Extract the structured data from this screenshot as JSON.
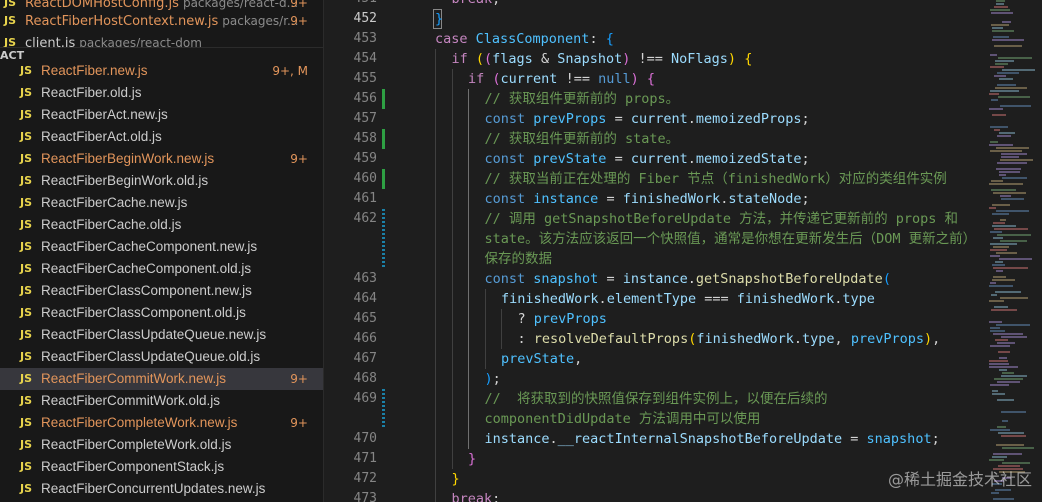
{
  "open_editors": [
    {
      "type": "JS",
      "name": "ReactDOMHostConfig.js",
      "path": "packages/react-d...",
      "badge": "9+"
    },
    {
      "type": "JS",
      "name": "ReactFiberHostContext.new.js",
      "path": "packages/r...",
      "badge": "9+"
    },
    {
      "type": "JS",
      "name": "client.js",
      "path": "packages/react-dom",
      "badge": ""
    }
  ],
  "section_title": "ACT",
  "files": [
    {
      "type": "JS",
      "name": "ReactFiber.new.js",
      "badge": "9+, M",
      "modified": true,
      "selected": false
    },
    {
      "type": "JS",
      "name": "ReactFiber.old.js",
      "badge": "",
      "modified": false,
      "selected": false
    },
    {
      "type": "JS",
      "name": "ReactFiberAct.new.js",
      "badge": "",
      "modified": false,
      "selected": false
    },
    {
      "type": "JS",
      "name": "ReactFiberAct.old.js",
      "badge": "",
      "modified": false,
      "selected": false
    },
    {
      "type": "JS",
      "name": "ReactFiberBeginWork.new.js",
      "badge": "9+",
      "modified": true,
      "selected": false
    },
    {
      "type": "JS",
      "name": "ReactFiberBeginWork.old.js",
      "badge": "",
      "modified": false,
      "selected": false
    },
    {
      "type": "JS",
      "name": "ReactFiberCache.new.js",
      "badge": "",
      "modified": false,
      "selected": false
    },
    {
      "type": "JS",
      "name": "ReactFiberCache.old.js",
      "badge": "",
      "modified": false,
      "selected": false
    },
    {
      "type": "JS",
      "name": "ReactFiberCacheComponent.new.js",
      "badge": "",
      "modified": false,
      "selected": false
    },
    {
      "type": "JS",
      "name": "ReactFiberCacheComponent.old.js",
      "badge": "",
      "modified": false,
      "selected": false
    },
    {
      "type": "JS",
      "name": "ReactFiberClassComponent.new.js",
      "badge": "",
      "modified": false,
      "selected": false
    },
    {
      "type": "JS",
      "name": "ReactFiberClassComponent.old.js",
      "badge": "",
      "modified": false,
      "selected": false
    },
    {
      "type": "JS",
      "name": "ReactFiberClassUpdateQueue.new.js",
      "badge": "",
      "modified": false,
      "selected": false
    },
    {
      "type": "JS",
      "name": "ReactFiberClassUpdateQueue.old.js",
      "badge": "",
      "modified": false,
      "selected": false
    },
    {
      "type": "JS",
      "name": "ReactFiberCommitWork.new.js",
      "badge": "9+",
      "modified": true,
      "selected": true
    },
    {
      "type": "JS",
      "name": "ReactFiberCommitWork.old.js",
      "badge": "",
      "modified": false,
      "selected": false
    },
    {
      "type": "JS",
      "name": "ReactFiberCompleteWork.new.js",
      "badge": "9+",
      "modified": true,
      "selected": false
    },
    {
      "type": "JS",
      "name": "ReactFiberCompleteWork.old.js",
      "badge": "",
      "modified": false,
      "selected": false
    },
    {
      "type": "JS",
      "name": "ReactFiberComponentStack.js",
      "badge": "",
      "modified": false,
      "selected": false
    },
    {
      "type": "JS",
      "name": "ReactFiberConcurrentUpdates.new.js",
      "badge": "",
      "modified": false,
      "selected": false
    }
  ],
  "editor": {
    "line_numbers": [
      "451",
      "452",
      "453",
      "454",
      "455",
      "456",
      "457",
      "458",
      "459",
      "460",
      "461",
      "462",
      "",
      "",
      "463",
      "464",
      "465",
      "466",
      "467",
      "468",
      "469",
      "",
      "470",
      "471",
      "472",
      "473"
    ],
    "active_line": "452",
    "code_lines": [
      {
        "indent": 1,
        "tokens": [
          {
            "t": "break",
            "c": "kw2"
          },
          {
            "t": ";",
            "c": "pn"
          }
        ]
      },
      {
        "indent": 0,
        "tokens": [
          {
            "t": "}",
            "c": "br3"
          }
        ]
      },
      {
        "indent": 0,
        "tokens": [
          {
            "t": "case ",
            "c": "kw2"
          },
          {
            "t": "ClassComponent",
            "c": "cst"
          },
          {
            "t": ": ",
            "c": "pn"
          },
          {
            "t": "{",
            "c": "br3"
          }
        ]
      },
      {
        "indent": 1,
        "tokens": [
          {
            "t": "if ",
            "c": "kw2"
          },
          {
            "t": "(",
            "c": "br1"
          },
          {
            "t": "(",
            "c": "br2"
          },
          {
            "t": "flags",
            "c": "var"
          },
          {
            "t": " & ",
            "c": "pn"
          },
          {
            "t": "Snapshot",
            "c": "var"
          },
          {
            "t": ")",
            "c": "br2"
          },
          {
            "t": " !== ",
            "c": "pn"
          },
          {
            "t": "NoFlags",
            "c": "var"
          },
          {
            "t": ")",
            "c": "br1"
          },
          {
            "t": " ",
            "c": "pn"
          },
          {
            "t": "{",
            "c": "br1"
          }
        ]
      },
      {
        "indent": 2,
        "tokens": [
          {
            "t": "if ",
            "c": "kw2"
          },
          {
            "t": "(",
            "c": "br2"
          },
          {
            "t": "current",
            "c": "var"
          },
          {
            "t": " !== ",
            "c": "pn"
          },
          {
            "t": "null",
            "c": "kw"
          },
          {
            "t": ")",
            "c": "br2"
          },
          {
            "t": " ",
            "c": "pn"
          },
          {
            "t": "{",
            "c": "br2"
          }
        ]
      },
      {
        "indent": 3,
        "tokens": [
          {
            "t": "// 获取组件更新前的 props。",
            "c": "cm"
          }
        ]
      },
      {
        "indent": 3,
        "tokens": [
          {
            "t": "const ",
            "c": "kw"
          },
          {
            "t": "prevProps",
            "c": "cst"
          },
          {
            "t": " = ",
            "c": "pn"
          },
          {
            "t": "current",
            "c": "var"
          },
          {
            "t": ".",
            "c": "pn"
          },
          {
            "t": "memoizedProps",
            "c": "var"
          },
          {
            "t": ";",
            "c": "pn"
          }
        ]
      },
      {
        "indent": 3,
        "tokens": [
          {
            "t": "// 获取组件更新前的 state。",
            "c": "cm"
          }
        ]
      },
      {
        "indent": 3,
        "tokens": [
          {
            "t": "const ",
            "c": "kw"
          },
          {
            "t": "prevState",
            "c": "cst"
          },
          {
            "t": " = ",
            "c": "pn"
          },
          {
            "t": "current",
            "c": "var"
          },
          {
            "t": ".",
            "c": "pn"
          },
          {
            "t": "memoizedState",
            "c": "var"
          },
          {
            "t": ";",
            "c": "pn"
          }
        ]
      },
      {
        "indent": 3,
        "tokens": [
          {
            "t": "// 获取当前正在处理的 Fiber 节点（finishedWork）对应的类组件实例",
            "c": "cm"
          }
        ]
      },
      {
        "indent": 3,
        "tokens": [
          {
            "t": "const ",
            "c": "kw"
          },
          {
            "t": "instance",
            "c": "cst"
          },
          {
            "t": " = ",
            "c": "pn"
          },
          {
            "t": "finishedWork",
            "c": "var"
          },
          {
            "t": ".",
            "c": "pn"
          },
          {
            "t": "stateNode",
            "c": "var"
          },
          {
            "t": ";",
            "c": "pn"
          }
        ]
      },
      {
        "indent": 3,
        "tokens": [
          {
            "t": "// 调用 getSnapshotBeforeUpdate 方法，并传递它更新前的 props 和",
            "c": "cm"
          }
        ]
      },
      {
        "indent": 3,
        "tokens": [
          {
            "t": "state。该方法应该返回一个快照值，通常是你想在更新发生后（DOM 更新之前）",
            "c": "cm"
          }
        ]
      },
      {
        "indent": 3,
        "tokens": [
          {
            "t": "保存的数据",
            "c": "cm"
          }
        ]
      },
      {
        "indent": 3,
        "tokens": [
          {
            "t": "const ",
            "c": "kw"
          },
          {
            "t": "snapshot",
            "c": "cst"
          },
          {
            "t": " = ",
            "c": "pn"
          },
          {
            "t": "instance",
            "c": "var"
          },
          {
            "t": ".",
            "c": "pn"
          },
          {
            "t": "getSnapshotBeforeUpdate",
            "c": "fn"
          },
          {
            "t": "(",
            "c": "br3"
          }
        ]
      },
      {
        "indent": 4,
        "tokens": [
          {
            "t": "finishedWork",
            "c": "var"
          },
          {
            "t": ".",
            "c": "pn"
          },
          {
            "t": "elementType",
            "c": "var"
          },
          {
            "t": " === ",
            "c": "pn"
          },
          {
            "t": "finishedWork",
            "c": "var"
          },
          {
            "t": ".",
            "c": "pn"
          },
          {
            "t": "type",
            "c": "var"
          }
        ]
      },
      {
        "indent": 5,
        "tokens": [
          {
            "t": "? ",
            "c": "pn"
          },
          {
            "t": "prevProps",
            "c": "cst"
          }
        ]
      },
      {
        "indent": 5,
        "tokens": [
          {
            "t": ": ",
            "c": "pn"
          },
          {
            "t": "resolveDefaultProps",
            "c": "fn"
          },
          {
            "t": "(",
            "c": "br1"
          },
          {
            "t": "finishedWork",
            "c": "var"
          },
          {
            "t": ".",
            "c": "pn"
          },
          {
            "t": "type",
            "c": "var"
          },
          {
            "t": ", ",
            "c": "pn"
          },
          {
            "t": "prevProps",
            "c": "cst"
          },
          {
            "t": ")",
            "c": "br1"
          },
          {
            "t": ",",
            "c": "pn"
          }
        ]
      },
      {
        "indent": 4,
        "tokens": [
          {
            "t": "prevState",
            "c": "cst"
          },
          {
            "t": ",",
            "c": "pn"
          }
        ]
      },
      {
        "indent": 3,
        "tokens": [
          {
            "t": ")",
            "c": "br3"
          },
          {
            "t": ";",
            "c": "pn"
          }
        ]
      },
      {
        "indent": 3,
        "tokens": [
          {
            "t": "//  将获取到的快照值保存到组件实例上，以便在后续的",
            "c": "cm"
          }
        ]
      },
      {
        "indent": 3,
        "tokens": [
          {
            "t": "componentDidUpdate 方法调用中可以使用",
            "c": "cm"
          }
        ]
      },
      {
        "indent": 3,
        "tokens": [
          {
            "t": "instance",
            "c": "var"
          },
          {
            "t": ".",
            "c": "pn"
          },
          {
            "t": "__reactInternalSnapshotBeforeUpdate",
            "c": "var"
          },
          {
            "t": " = ",
            "c": "pn"
          },
          {
            "t": "snapshot",
            "c": "cst"
          },
          {
            "t": ";",
            "c": "pn"
          }
        ]
      },
      {
        "indent": 2,
        "tokens": [
          {
            "t": "}",
            "c": "br2"
          }
        ]
      },
      {
        "indent": 1,
        "tokens": [
          {
            "t": "}",
            "c": "br1"
          }
        ]
      },
      {
        "indent": 1,
        "tokens": [
          {
            "t": "break",
            "c": "kw2"
          },
          {
            "t": ";",
            "c": "pn"
          }
        ]
      }
    ]
  },
  "watermark": "@稀土掘金技术社区",
  "colors": {
    "modified": "#e2955b",
    "js_icon": "#e8d44d",
    "git_added": "#2ea043",
    "git_modified": "#1b81a8"
  }
}
